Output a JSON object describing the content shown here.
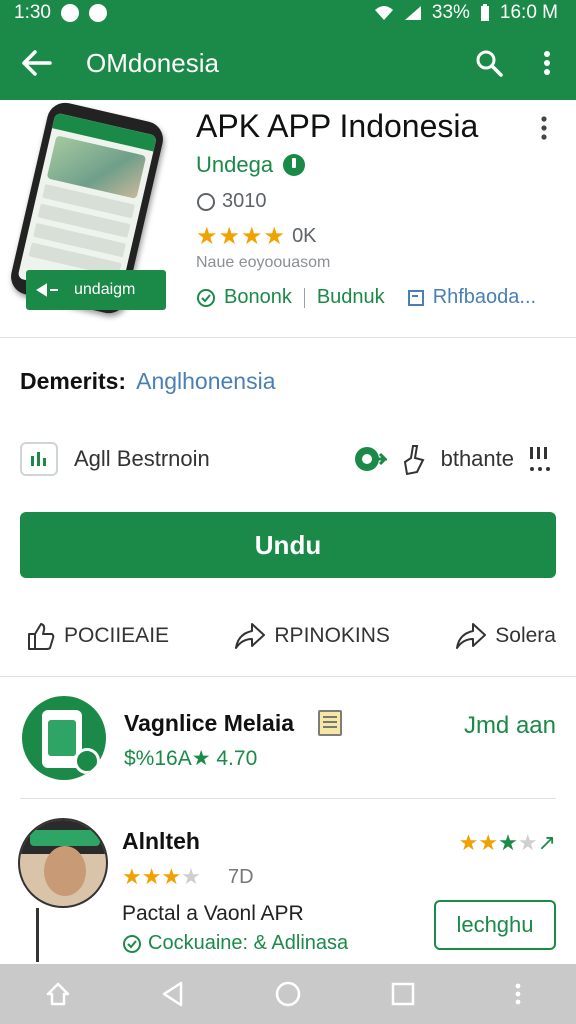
{
  "status_bar": {
    "time": "1:30",
    "battery": "33%",
    "clock": "16:0 M"
  },
  "app_bar": {
    "title": "OMdonesia"
  },
  "hero": {
    "badge_text": "undaigm",
    "title": "APK APP Indonesia",
    "developer": "Undega",
    "size": "3010",
    "rating_count": "0K",
    "meta": "Naue eoyoouasom",
    "tags": [
      "Bononk",
      "Budnuk",
      "Rhfbaoda..."
    ]
  },
  "details": {
    "label": "Demerits:",
    "value": "Anglhonensia",
    "feature_name": "Agll Bestrnoin",
    "feature_right": "bthante"
  },
  "install_button": {
    "label": "Undu"
  },
  "actions": [
    {
      "label": "POCIIEAIE",
      "icon": "thumbs-up-icon"
    },
    {
      "label": "RPINOKINS",
      "icon": "share-icon"
    },
    {
      "label": "Solera",
      "icon": "share-icon"
    }
  ],
  "related": [
    {
      "title": "Vagnlice Melaia",
      "subtitle": "$%16A★ 4.70",
      "cta": "Jmd aan"
    },
    {
      "title": "Alnlteh",
      "count": "7D",
      "description": "Pactal a Vaonl APR",
      "feature": "Cockuaine: & Adlinasa",
      "button": "lechghu"
    }
  ],
  "colors": {
    "primary": "#1b8a48",
    "star": "#f2a200",
    "link": "#4a7fb5"
  }
}
